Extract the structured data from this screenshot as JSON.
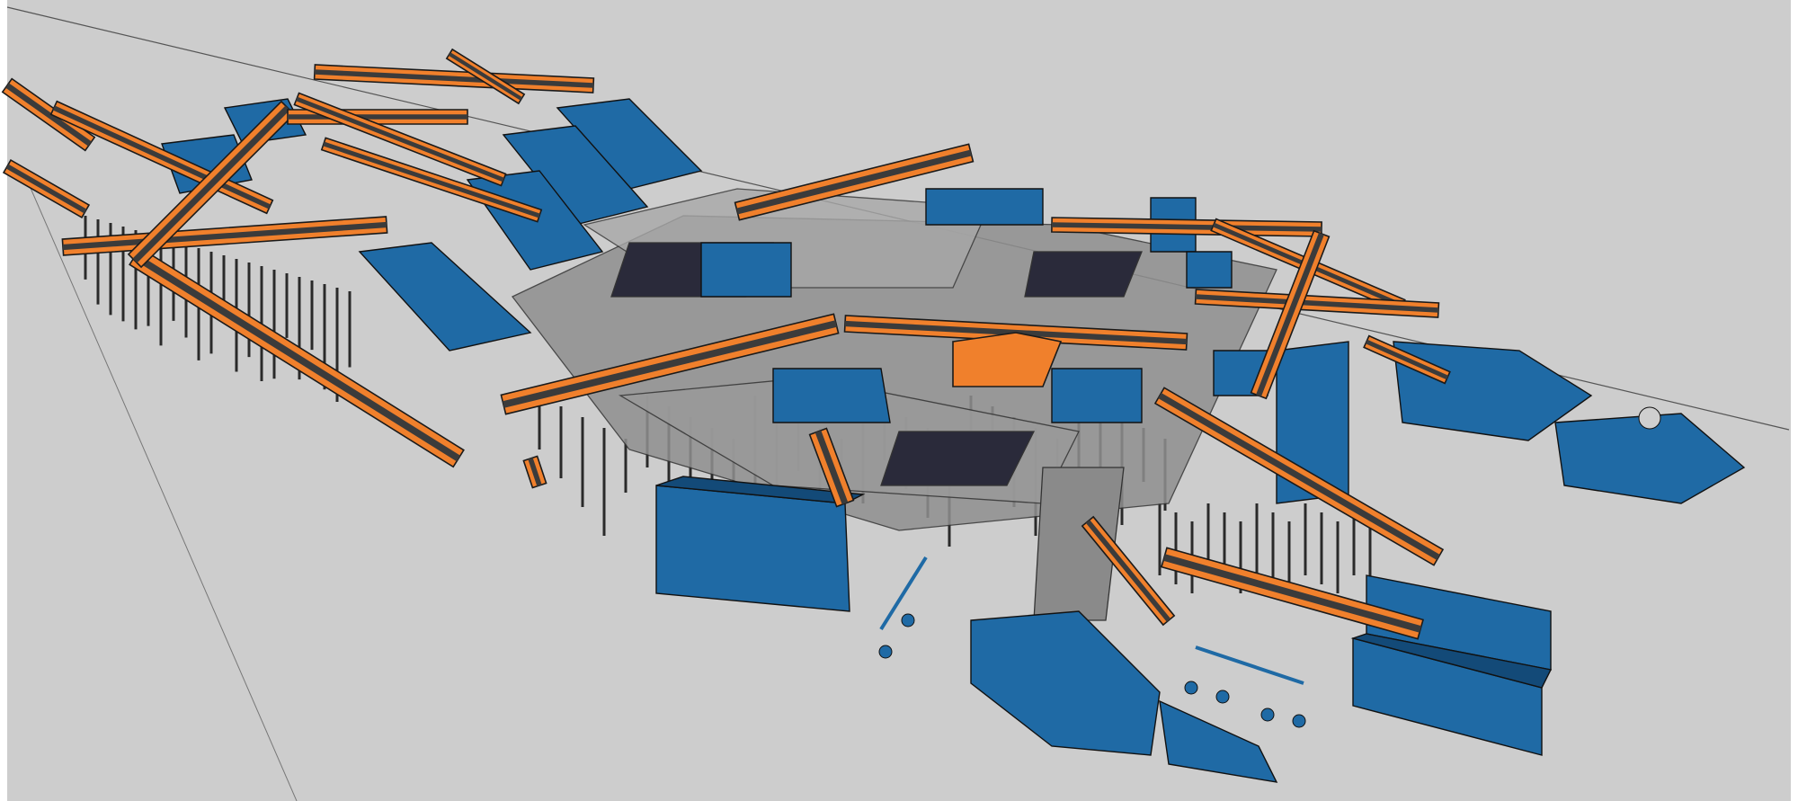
{
  "viewport": {
    "background": "#cdcdcd",
    "border": "#ffffff"
  },
  "scene": {
    "description_icon": "3d-model-recycling-plant-icon",
    "colors": {
      "conveyor": "#f0802c",
      "conveyor_belt": "#3b3b3b",
      "machine": "#1f6aa5",
      "machine_dark": "#134a78",
      "platform": "#8f8f8f",
      "platform_light": "#a8a8a8",
      "support": "#2a2a2a",
      "axis_line": "#555555"
    }
  }
}
